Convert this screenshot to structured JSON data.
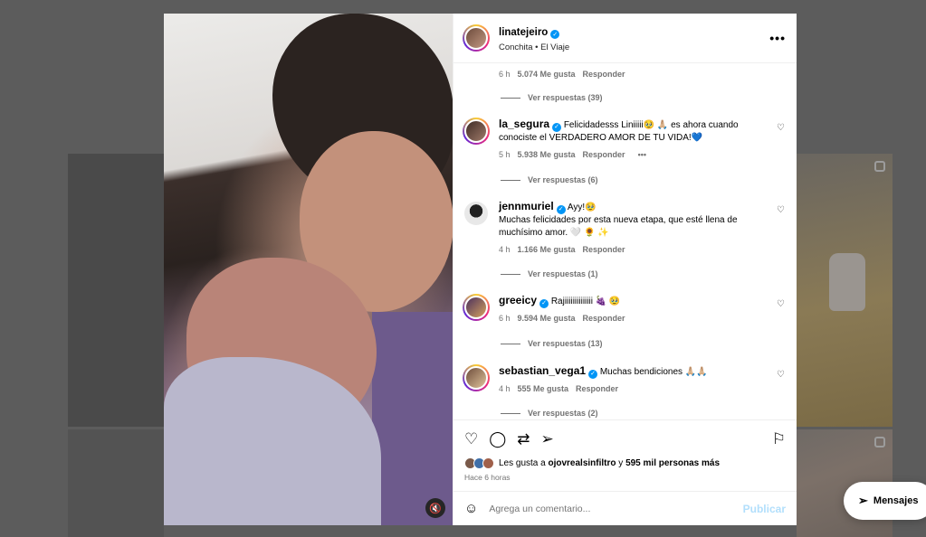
{
  "post": {
    "username": "linatejeiro",
    "audio": "Conchita • El Viaje",
    "more_icon": "more-horizontal-icon"
  },
  "top_meta": {
    "time": "6 h",
    "likes": "5.074 Me gusta",
    "reply": "Responder",
    "view_replies": "Ver respuestas (39)"
  },
  "comments": [
    {
      "username": "la_segura",
      "text": "Felicidadesss Liniiiii🥹 🙏🏼 es ahora cuando conociste el VERDADERO AMOR DE TU VIDA!💙",
      "time": "5 h",
      "likes": "5.938 Me gusta",
      "reply": "Responder",
      "more": "•••",
      "view_replies": "Ver respuestas (6)"
    },
    {
      "username": "jennmuriel",
      "text": "Ayy!🥹",
      "text2": "Muchas felicidades por esta nueva etapa, que esté llena de muchísimo amor. 🤍 🌻 ✨",
      "time": "4 h",
      "likes": "1.166 Me gusta",
      "reply": "Responder",
      "view_replies": "Ver respuestas (1)"
    },
    {
      "username": "greeicy",
      "text": "Rajiiiiiiiiiiiiii 🍇 🥹",
      "time": "6 h",
      "likes": "9.594 Me gusta",
      "reply": "Responder",
      "view_replies": "Ver respuestas (13)"
    },
    {
      "username": "sebastian_vega1",
      "text": "Muchas bendiciones 🙏🏼🙏🏼",
      "time": "4 h",
      "likes": "555 Me gusta",
      "reply": "Responder",
      "view_replies": "Ver respuestas (2)"
    }
  ],
  "actions": {
    "like_icon": "heart-icon",
    "comment_icon": "comment-icon",
    "repost_icon": "repost-icon",
    "share_icon": "share-icon",
    "save_icon": "bookmark-icon"
  },
  "likes_summary": {
    "prefix": "Les gusta a ",
    "user": "ojovrealsinfiltro",
    "middle": " y ",
    "others": "595 mil personas más",
    "time": "Hace 6 horas"
  },
  "composer": {
    "placeholder": "Agrega un comentario...",
    "publish": "Publicar"
  },
  "messages": {
    "label": "Mensajes"
  },
  "colors": {
    "accent": "#0095f6",
    "publish_disabled": "#b2dffc"
  }
}
